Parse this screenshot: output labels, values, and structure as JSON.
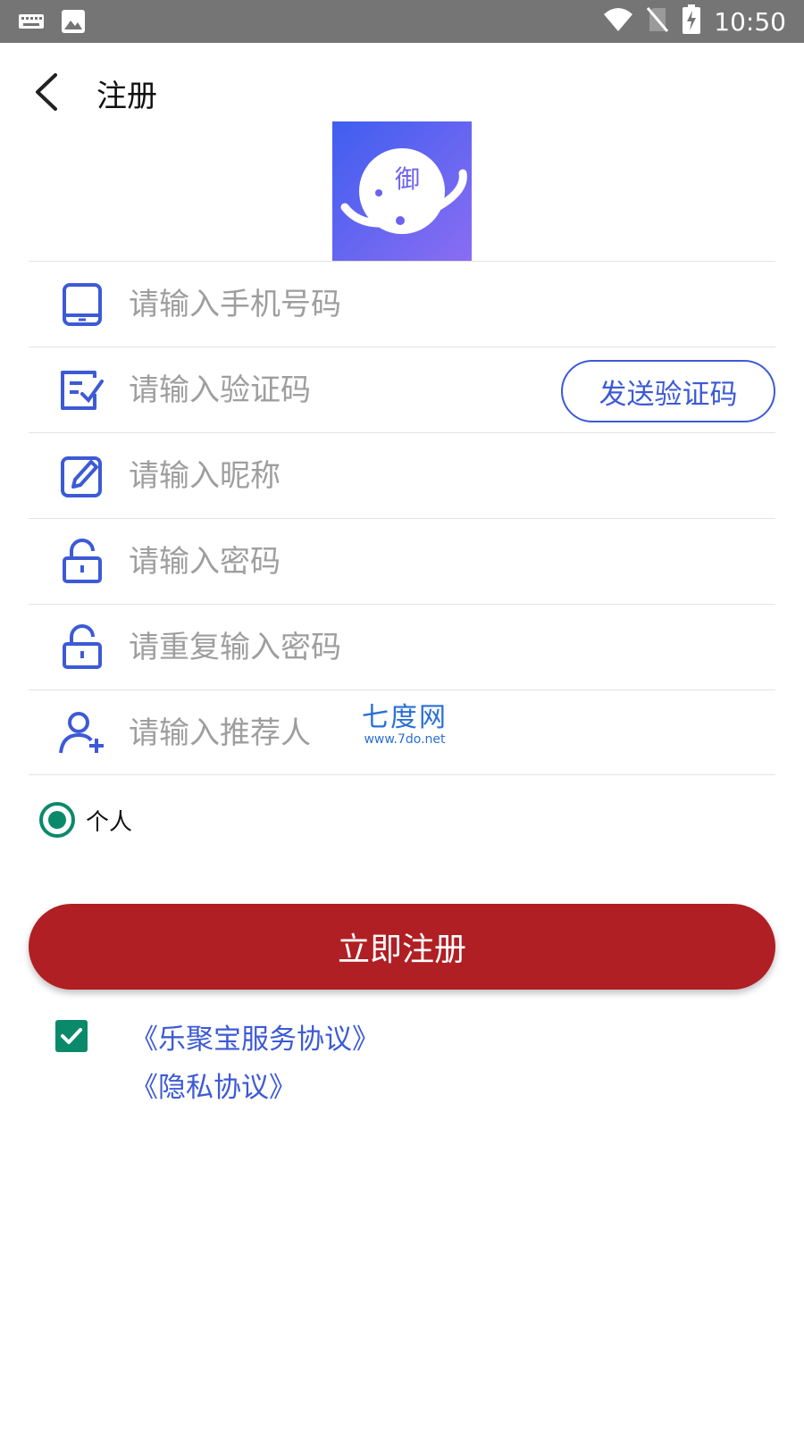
{
  "status_bar": {
    "time": "10:50",
    "background": "#757575",
    "left_icons": [
      "keyboard-icon",
      "image-icon"
    ],
    "right_icons": [
      "wifi-icon",
      "no-sim-icon",
      "battery-charging-icon"
    ]
  },
  "header": {
    "title": "注册",
    "back_icon": "chevron-left-icon"
  },
  "logo": {
    "glyph": "御",
    "colors": [
      "#3f5ef0",
      "#8a6df2"
    ]
  },
  "form": {
    "phone": {
      "placeholder": "请输入手机号码",
      "icon": "phone-icon"
    },
    "code": {
      "placeholder": "请输入验证码",
      "icon": "checklist-icon",
      "send_button": "发送验证码"
    },
    "nickname": {
      "placeholder": "请输入昵称",
      "icon": "edit-icon"
    },
    "password": {
      "placeholder": "请输入密码",
      "icon": "lock-icon"
    },
    "password_repeat": {
      "placeholder": "请重复输入密码",
      "icon": "lock-icon"
    },
    "referrer": {
      "placeholder": "请输入推荐人",
      "icon": "add-user-icon"
    }
  },
  "watermark": {
    "main": "七度网",
    "sub": "www.7do.net"
  },
  "account_type": {
    "label": "个人",
    "selected": true
  },
  "submit": {
    "label": "立即注册"
  },
  "agreement": {
    "checked": true,
    "service_link": "《乐聚宝服务协议》",
    "privacy_link": "《隐私协议》"
  },
  "colors": {
    "accent_blue": "#3d5ad6",
    "submit_red": "#b01f24",
    "check_green": "#0b8a6b",
    "placeholder_gray": "#9e9e9e",
    "divider": "#e3e3e3"
  }
}
